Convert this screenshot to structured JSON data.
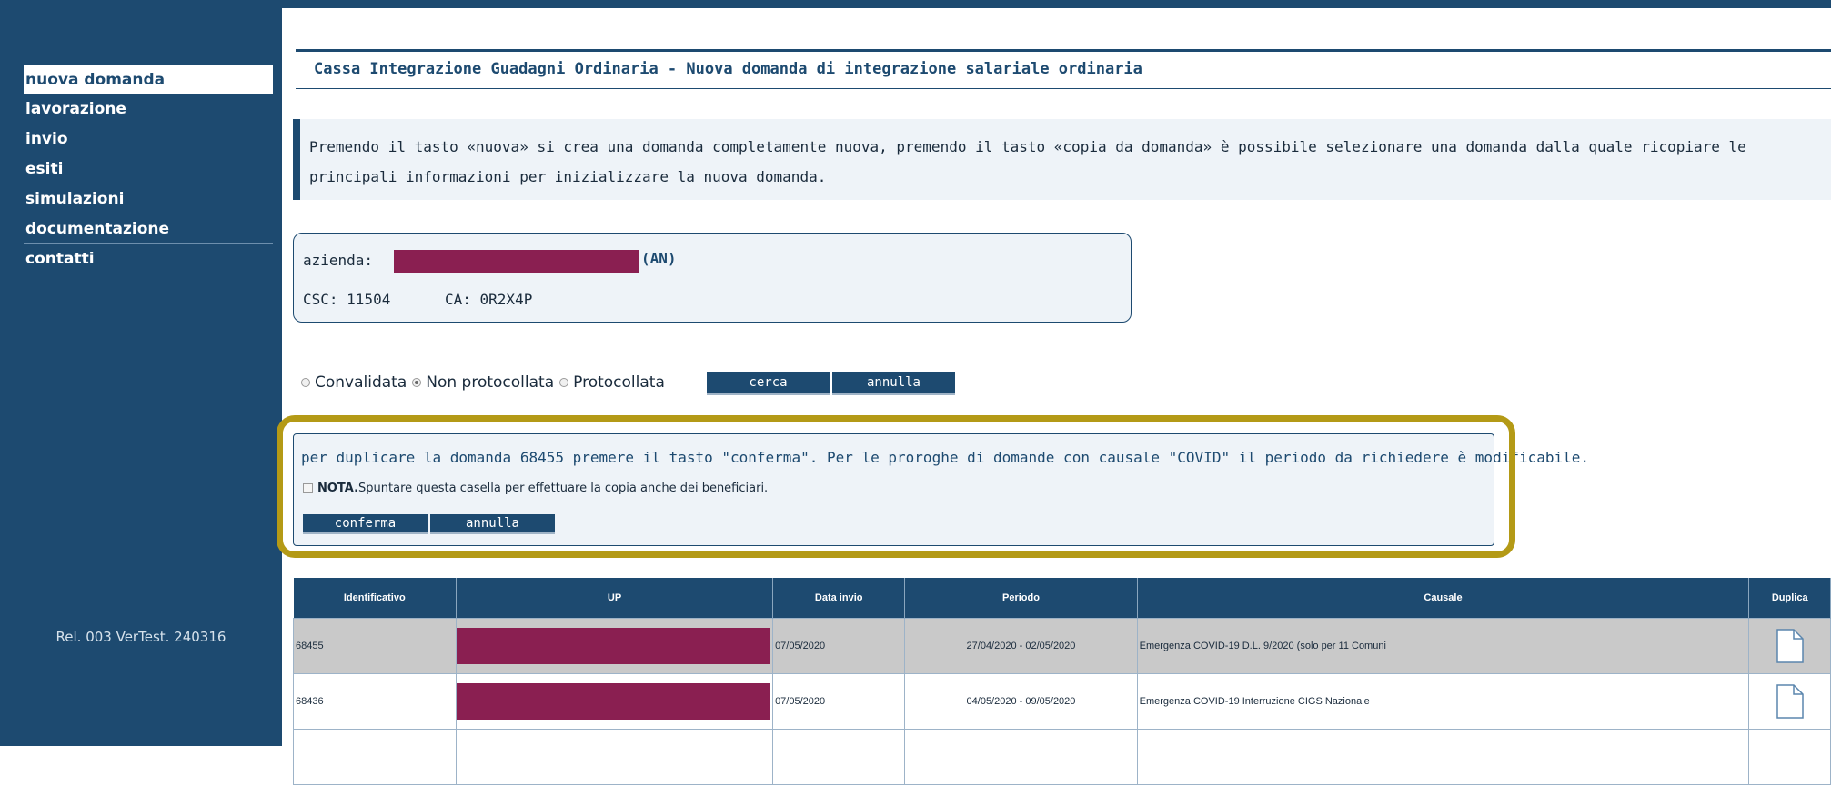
{
  "sidebar": {
    "items": [
      {
        "label": "nuova domanda",
        "active": true
      },
      {
        "label": "lavorazione"
      },
      {
        "label": "invio"
      },
      {
        "label": "esiti"
      },
      {
        "label": "simulazioni"
      },
      {
        "label": "documentazione"
      },
      {
        "label": "contatti"
      }
    ],
    "release": "Rel. 003 VerTest. 240316"
  },
  "page": {
    "title": "Cassa Integrazione Guadagni Ordinaria - Nuova domanda di integrazione salariale ordinaria",
    "info": "Premendo il tasto «nuova» si crea una domanda completamente nuova, premendo il tasto «copia da domanda» è possibile selezionare una domanda dalla quale ricopiare le principali informazioni per inizializzare la nuova domanda."
  },
  "company": {
    "label": "azienda:",
    "suffix": "(AN)",
    "csc": "CSC: 11504",
    "ca": "CA: 0R2X4P"
  },
  "filters": {
    "options": [
      {
        "label": "Convalidata",
        "checked": false
      },
      {
        "label": "Non protocollata",
        "checked": true
      },
      {
        "label": "Protocollata",
        "checked": false
      }
    ],
    "search_label": "cerca",
    "cancel_label": "annulla"
  },
  "confirm": {
    "message": "per duplicare la domanda 68455 premere il tasto \"conferma\". Per le proroghe di domande con causale \"COVID\" il periodo da richiedere è modificabile.",
    "nota_bold": "NOTA.",
    "nota_text": "Spuntare questa casella per effettuare la copia anche dei beneficiari.",
    "confirm_label": "conferma",
    "cancel_label": "annulla",
    "highlight_color": "#b49a16"
  },
  "table": {
    "headers": [
      "Identificativo",
      "UP",
      "Data invio",
      "Periodo",
      "Causale",
      "Duplica"
    ],
    "rows": [
      {
        "id": "68455",
        "data_invio": "07/05/2020",
        "periodo": "27/04/2020 - 02/05/2020",
        "causale": "Emergenza COVID-19 D.L. 9/2020 (solo per 11 Comuni",
        "selected": true
      },
      {
        "id": "68436",
        "data_invio": "07/05/2020",
        "periodo": "04/05/2020 - 09/05/2020",
        "causale": "Emergenza COVID-19 Interruzione CIGS Nazionale",
        "selected": false
      }
    ]
  },
  "colors": {
    "primary": "#1d4a70",
    "redaction": "#8a1f51",
    "panel": "#eef3f8"
  }
}
